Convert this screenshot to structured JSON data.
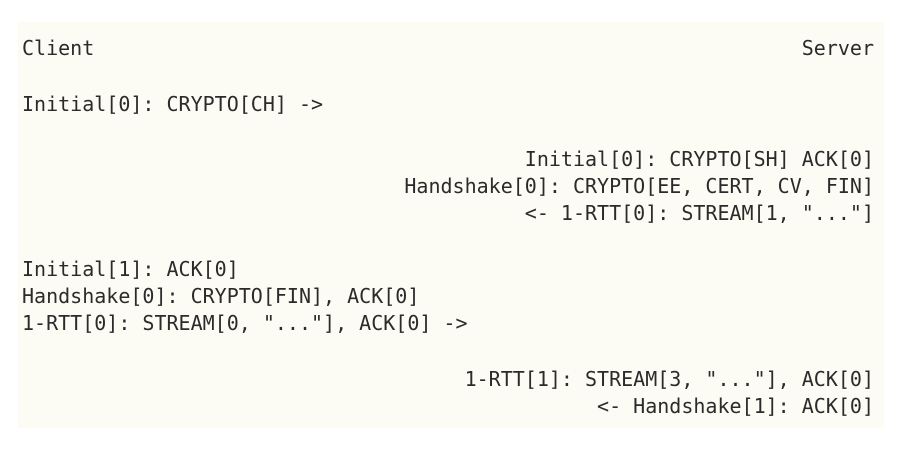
{
  "header": {
    "client_label": "Client",
    "server_label": "Server"
  },
  "flights": [
    {
      "side": "client",
      "lines": [
        "Initial[0]: CRYPTO[CH] ->"
      ]
    },
    {
      "side": "server",
      "lines": [
        "Initial[0]: CRYPTO[SH] ACK[0]",
        "Handshake[0]: CRYPTO[EE, CERT, CV, FIN]",
        "<- 1-RTT[0]: STREAM[1, \"...\"]"
      ]
    },
    {
      "side": "client",
      "lines": [
        "Initial[1]: ACK[0]",
        "Handshake[0]: CRYPTO[FIN], ACK[0]",
        "1-RTT[0]: STREAM[0, \"...\"], ACK[0] ->"
      ]
    },
    {
      "side": "server",
      "lines": [
        "1-RTT[1]: STREAM[3, \"...\"], ACK[0]",
        "<- Handshake[1]: ACK[0]"
      ]
    }
  ]
}
